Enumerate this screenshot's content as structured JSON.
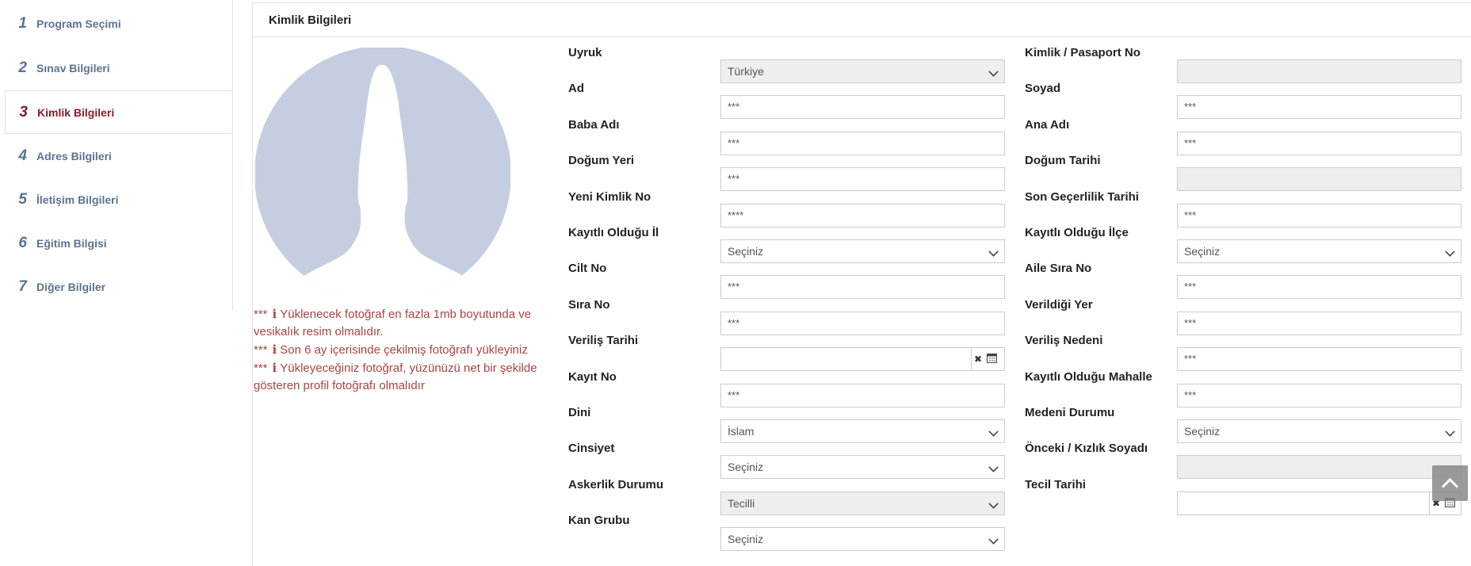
{
  "sidebar": {
    "items": [
      {
        "num": "1",
        "label": "Program Seçimi"
      },
      {
        "num": "2",
        "label": "Sınav Bilgileri"
      },
      {
        "num": "3",
        "label": "Kimlik Bilgileri"
      },
      {
        "num": "4",
        "label": "Adres Bilgileri"
      },
      {
        "num": "5",
        "label": "İletişim Bilgileri"
      },
      {
        "num": "6",
        "label": "Eğitim Bilgisi"
      },
      {
        "num": "7",
        "label": "Diğer Bilgiler"
      }
    ]
  },
  "panel": {
    "title": "Kimlik Bilgileri"
  },
  "notes": [
    {
      "stars": "***",
      "text": "Yüklenecek fotoğraf en fazla 1mb boyutunda ve vesikalık resim olmalıdır."
    },
    {
      "stars": "***",
      "text": "Son 6 ay içerisinde çekilmiş fotoğrafı yükleyiniz"
    },
    {
      "stars": "***",
      "text": "Yükleyeceğiniz fotoğraf, yüzünüzü net bir şekilde gösteren profil fotoğrafı olmalıdır"
    }
  ],
  "form": {
    "left": [
      {
        "label": "Uyruk",
        "value": "Türkiye",
        "kind": "select",
        "disabled": true
      },
      {
        "label": "Ad",
        "value": "***",
        "kind": "text"
      },
      {
        "label": "Baba Adı",
        "value": "***",
        "kind": "text"
      },
      {
        "label": "Doğum Yeri",
        "value": "***",
        "kind": "text"
      },
      {
        "label": "Yeni Kimlik No",
        "value": "****",
        "kind": "text"
      },
      {
        "label": "Kayıtlı Olduğu İl",
        "value": "Seçiniz",
        "kind": "select"
      },
      {
        "label": "Cilt No",
        "value": "***",
        "kind": "text"
      },
      {
        "label": "Sıra No",
        "value": "***",
        "kind": "text"
      },
      {
        "label": "Veriliş Tarihi",
        "value": "",
        "kind": "date"
      },
      {
        "label": "Kayıt No",
        "value": "***",
        "kind": "text"
      },
      {
        "label": "Dini",
        "value": "İslam",
        "kind": "select"
      },
      {
        "label": "Cinsiyet",
        "value": "Seçiniz",
        "kind": "select"
      },
      {
        "label": "Askerlik Durumu",
        "value": "Tecilli",
        "kind": "select",
        "disabled": true
      },
      {
        "label": "Kan Grubu",
        "value": "Seçiniz",
        "kind": "select"
      }
    ],
    "right": [
      {
        "label": "Kimlik / Pasaport No",
        "value": "",
        "kind": "text",
        "disabled": true
      },
      {
        "label": "Soyad",
        "value": "***",
        "kind": "text"
      },
      {
        "label": "Ana Adı",
        "value": "***",
        "kind": "text"
      },
      {
        "label": "Doğum Tarihi",
        "value": "",
        "kind": "text",
        "disabled": true
      },
      {
        "label": "Son Geçerlilik Tarihi",
        "value": "***",
        "kind": "text"
      },
      {
        "label": "Kayıtlı Olduğu İlçe",
        "value": "Seçiniz",
        "kind": "select"
      },
      {
        "label": "Aile Sıra No",
        "value": "***",
        "kind": "text"
      },
      {
        "label": "Verildiği Yer",
        "value": "***",
        "kind": "text"
      },
      {
        "label": "Veriliş Nedeni",
        "value": "***",
        "kind": "text"
      },
      {
        "label": "Kayıtlı Olduğu Mahalle",
        "value": "***",
        "kind": "text"
      },
      {
        "label": "Medeni Durumu",
        "value": "Seçiniz",
        "kind": "select"
      },
      {
        "label": "Önceki / Kızlık Soyadı",
        "value": "",
        "kind": "text",
        "disabled": true
      },
      {
        "label": "Tecil Tarihi",
        "value": "",
        "kind": "date"
      }
    ]
  },
  "icons": {
    "clear": "times-icon",
    "calendar": "calendar-icon",
    "scroll_top": "chevron-up-icon"
  },
  "colors": {
    "accent": "#8b1a2b",
    "nav": "#5a7391",
    "warning_text": "#a94442",
    "avatar": "#c5cee0"
  }
}
